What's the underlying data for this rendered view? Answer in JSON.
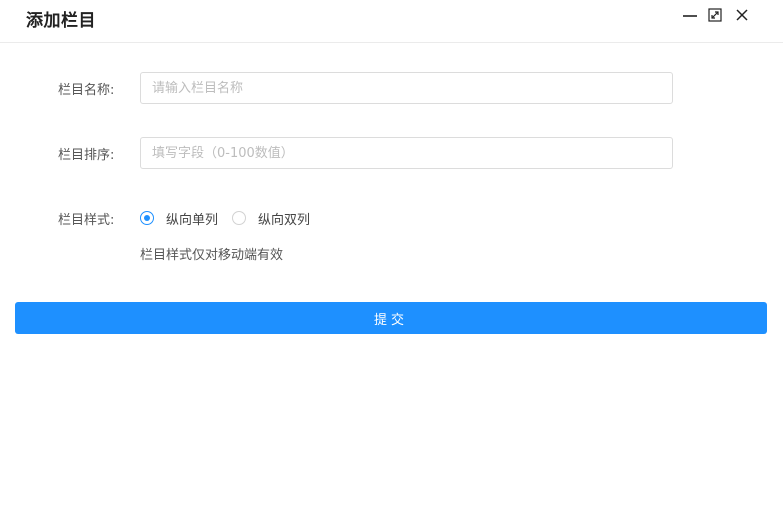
{
  "dialog": {
    "title": "添加栏目"
  },
  "form": {
    "name": {
      "label": "栏目名称:",
      "placeholder": "请输入栏目名称",
      "value": ""
    },
    "order": {
      "label": "栏目排序:",
      "placeholder": "填写字段（0-100数值）",
      "value": ""
    },
    "style": {
      "label": "栏目样式:",
      "options": [
        {
          "label": "纵向单列",
          "checked": true
        },
        {
          "label": "纵向双列",
          "checked": false
        }
      ],
      "hint": "栏目样式仅对移动端有效"
    },
    "submit_label": "提交"
  },
  "colors": {
    "accent": "#1e90ff"
  },
  "icons": {
    "minimize": "minimize-icon",
    "maximize": "maximize-icon",
    "close": "close-icon"
  }
}
